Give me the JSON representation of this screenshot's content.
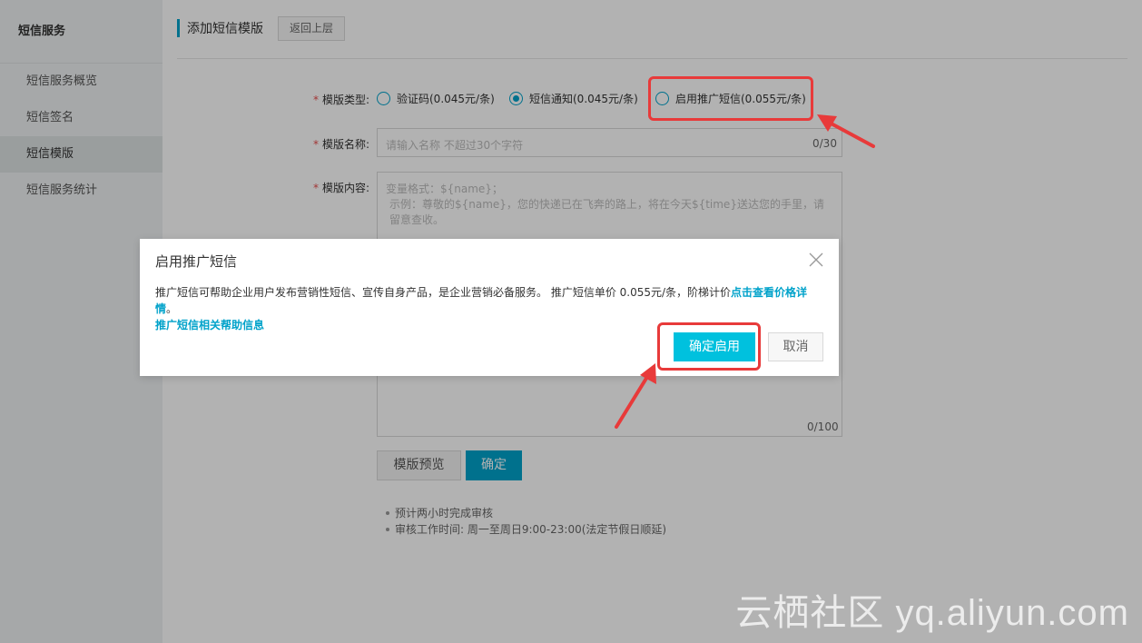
{
  "sidebar": {
    "title": "短信服务",
    "items": [
      {
        "label": "短信服务概览"
      },
      {
        "label": "短信签名"
      },
      {
        "label": "短信模版"
      },
      {
        "label": "短信服务统计"
      }
    ]
  },
  "header": {
    "title": "添加短信模版",
    "back_label": "返回上层"
  },
  "form": {
    "type_label": "模版类型:",
    "type_options": [
      {
        "label": "验证码(0.045元/条)",
        "selected": false
      },
      {
        "label": "短信通知(0.045元/条)",
        "selected": true
      },
      {
        "label": "启用推广短信(0.055元/条)",
        "selected": false
      }
    ],
    "name_label": "模版名称:",
    "name_placeholder": "请输入名称 不超过30个字符",
    "name_counter": "0/30",
    "content_label": "模版内容:",
    "content_placeholder_line1": "变量格式：${name}；",
    "content_placeholder_line2": "示例：尊敬的${name}，您的快递已在飞奔的路上，将在今天${time}送达您的手里，请留意查收。",
    "content_counter": "0/100",
    "preview_button": "模版预览",
    "confirm_button": "确定",
    "tips": [
      "预计两小时完成审核",
      "审核工作时间: 周一至周日9:00-23:00(法定节假日顺延)"
    ]
  },
  "dialog": {
    "title": "启用推广短信",
    "body_text": "推广短信可帮助企业用户发布营销性短信、宣传自身产品，是企业营销必备服务。 推广短信单价 0.055元/条，阶梯计价",
    "price_link": "点击查看价格详情",
    "period": "。",
    "help_link": "推广短信相关帮助信息",
    "ok_button": "确定启用",
    "cancel_button": "取消"
  },
  "watermark": "云栖社区 yq.aliyun.com",
  "colors": {
    "accent": "#00a2ca",
    "dialog_ok": "#00c1de",
    "highlight": "#e83a3a"
  }
}
